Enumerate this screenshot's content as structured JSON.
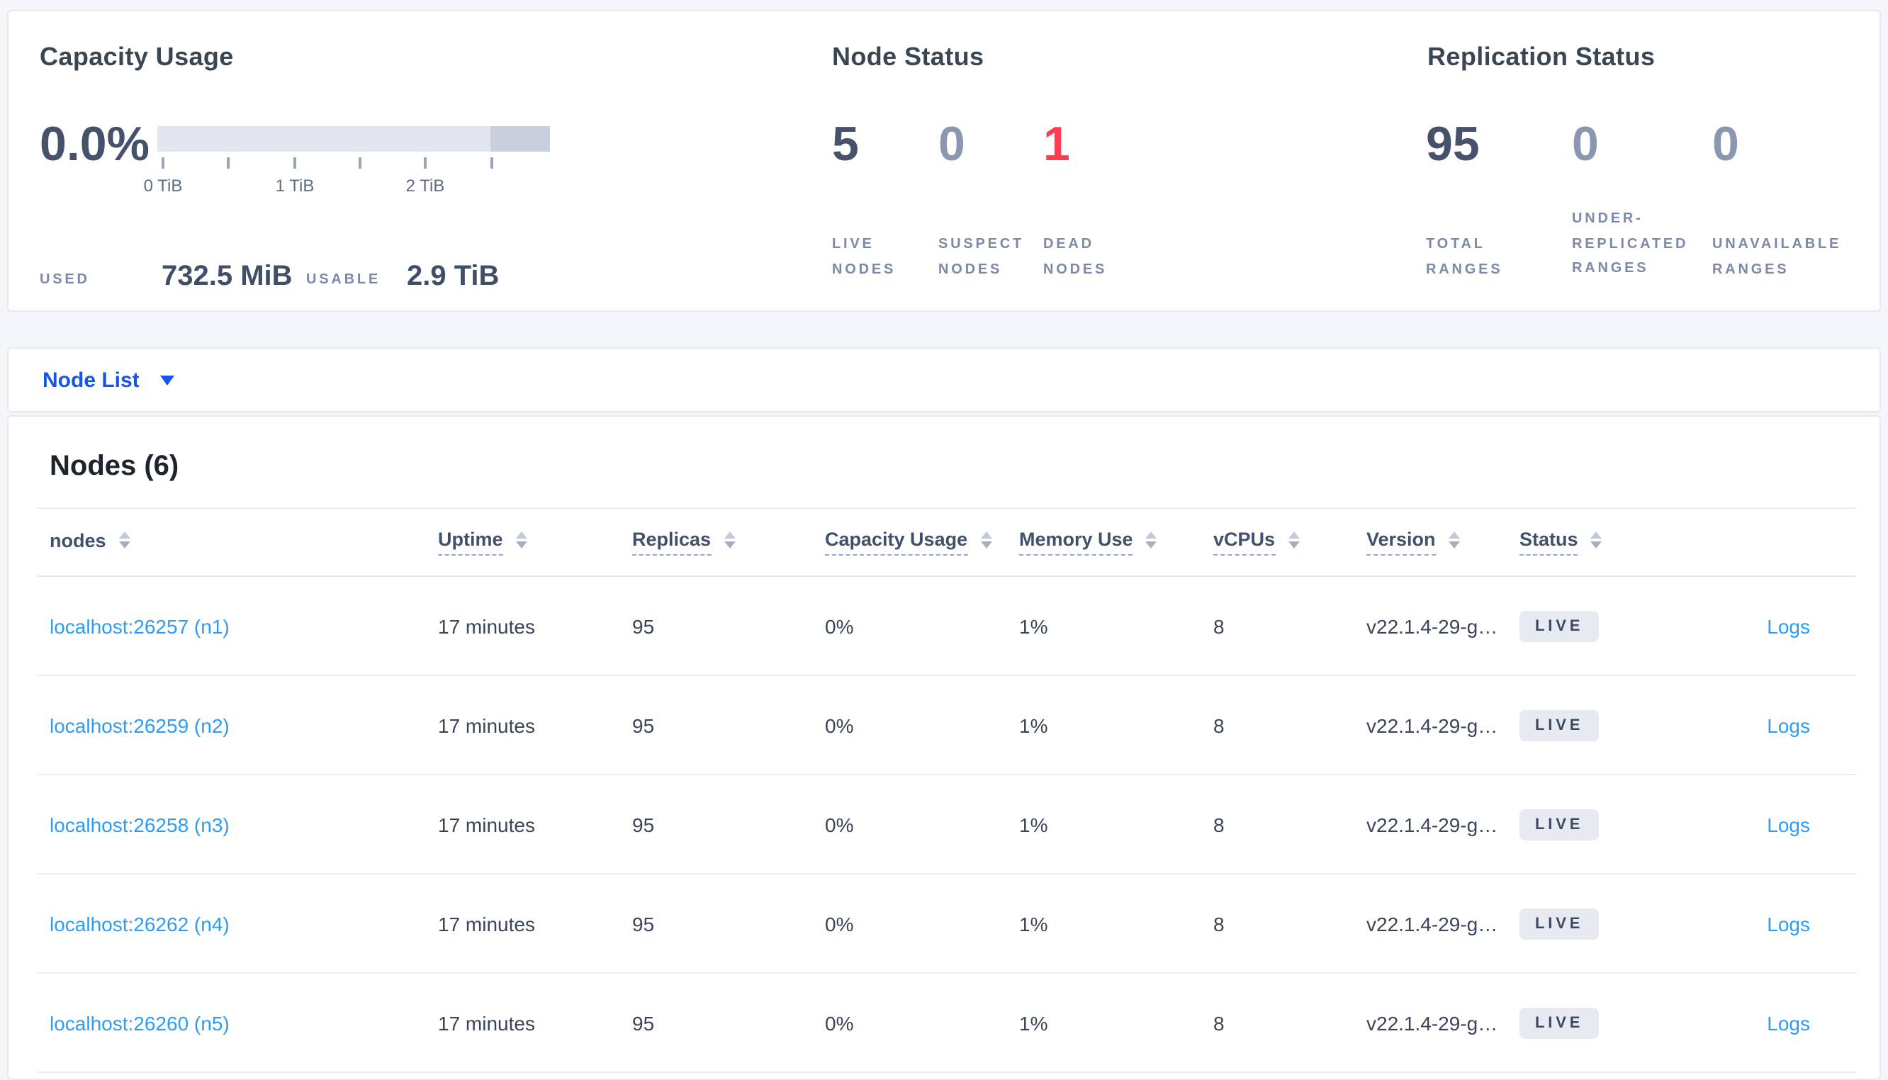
{
  "overview": {
    "capacity": {
      "title": "Capacity Usage",
      "percent": "0.0%",
      "tick_labels": [
        "0 TiB",
        "1 TiB",
        "2 TiB"
      ],
      "used_label": "USED",
      "used_value": "732.5 MiB",
      "usable_label": "USABLE",
      "usable_value": "2.9 TiB"
    },
    "node_status": {
      "title": "Node Status",
      "stats": [
        {
          "value": "5",
          "label_lines": [
            "LIVE",
            "NODES"
          ]
        },
        {
          "value": "0",
          "label_lines": [
            "SUSPECT",
            "NODES"
          ]
        },
        {
          "value": "1",
          "label_lines": [
            "DEAD",
            "NODES"
          ]
        }
      ]
    },
    "replication": {
      "title": "Replication Status",
      "stats": [
        {
          "value": "95",
          "label_lines": [
            "TOTAL",
            "RANGES"
          ]
        },
        {
          "value": "0",
          "label_lines": [
            "UNDER-",
            "REPLICATED",
            "RANGES"
          ]
        },
        {
          "value": "0",
          "label_lines": [
            "UNAVAILABLE",
            "RANGES"
          ]
        }
      ]
    }
  },
  "node_list_bar": {
    "label": "Node List"
  },
  "nodes_section": {
    "heading": "Nodes (6)",
    "columns": [
      {
        "label": "nodes"
      },
      {
        "label": "Uptime"
      },
      {
        "label": "Replicas"
      },
      {
        "label": "Capacity Usage"
      },
      {
        "label": "Memory Use"
      },
      {
        "label": "vCPUs"
      },
      {
        "label": "Version"
      },
      {
        "label": "Status"
      }
    ],
    "rows": [
      {
        "address": "localhost:26257 (n1)",
        "uptime": "17 minutes",
        "replicas": "95",
        "capacity": "0%",
        "memory": "1%",
        "vcpus": "8",
        "version": "v22.1.4-29-g…",
        "status": "LIVE",
        "logs": "Logs"
      },
      {
        "address": "localhost:26259 (n2)",
        "uptime": "17 minutes",
        "replicas": "95",
        "capacity": "0%",
        "memory": "1%",
        "vcpus": "8",
        "version": "v22.1.4-29-g…",
        "status": "LIVE",
        "logs": "Logs"
      },
      {
        "address": "localhost:26258 (n3)",
        "uptime": "17 minutes",
        "replicas": "95",
        "capacity": "0%",
        "memory": "1%",
        "vcpus": "8",
        "version": "v22.1.4-29-g…",
        "status": "LIVE",
        "logs": "Logs"
      },
      {
        "address": "localhost:26262 (n4)",
        "uptime": "17 minutes",
        "replicas": "95",
        "capacity": "0%",
        "memory": "1%",
        "vcpus": "8",
        "version": "v22.1.4-29-g…",
        "status": "LIVE",
        "logs": "Logs"
      },
      {
        "address": "localhost:26260 (n5)",
        "uptime": "17 minutes",
        "replicas": "95",
        "capacity": "0%",
        "memory": "1%",
        "vcpus": "8",
        "version": "v22.1.4-29-g…",
        "status": "LIVE",
        "logs": "Logs"
      }
    ]
  },
  "colors": {
    "dropdown_blue": "#1556e9",
    "link_blue": "#2d9cf4",
    "dead_red": "#ff3c52",
    "badge_bg": "#e7eaf1",
    "gauge_light": "#e3e6ee",
    "gauge_dark": "#c9cfdc"
  }
}
